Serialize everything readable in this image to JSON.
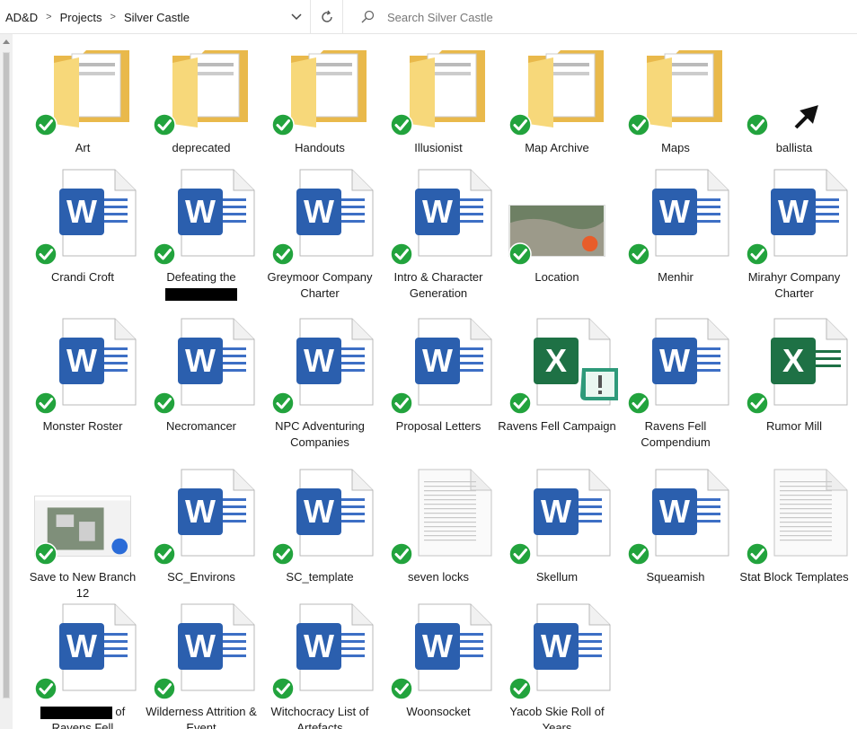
{
  "breadcrumb": [
    "AD&D",
    "Projects",
    "Silver Castle"
  ],
  "search": {
    "placeholder": "Search Silver Castle"
  },
  "icons": {
    "refresh": "refresh-icon",
    "search": "search-icon",
    "chevron": "chevron-down-icon",
    "sync": "synced-check-icon"
  },
  "colors": {
    "word": "#2b5fae",
    "excel": "#1e7145",
    "folder": "#f5d06b",
    "check": "#22a33d"
  },
  "items": [
    {
      "label": "Art",
      "type": "folder"
    },
    {
      "label": "deprecated",
      "type": "folder"
    },
    {
      "label": "Handouts",
      "type": "folder"
    },
    {
      "label": "Illusionist",
      "type": "folder"
    },
    {
      "label": "Map Archive",
      "type": "folder"
    },
    {
      "label": "Maps",
      "type": "folder"
    },
    {
      "label": "ballista",
      "type": "image"
    },
    {
      "label": "Crandi Croft",
      "type": "word"
    },
    {
      "label": "Defeating the",
      "type": "word",
      "redacted": true
    },
    {
      "label": "Greymoor Company Charter",
      "type": "word"
    },
    {
      "label": "Intro & Character Generation",
      "type": "word"
    },
    {
      "label": "Location",
      "type": "image"
    },
    {
      "label": "Menhir",
      "type": "word"
    },
    {
      "label": "Mirahyr Company Charter",
      "type": "word"
    },
    {
      "label": "Monster Roster",
      "type": "word"
    },
    {
      "label": "Necromancer",
      "type": "word"
    },
    {
      "label": "NPC Adventuring Companies",
      "type": "word"
    },
    {
      "label": "Proposal Letters",
      "type": "word"
    },
    {
      "label": "Ravens Fell Campaign",
      "type": "excel"
    },
    {
      "label": "Ravens Fell Compendium",
      "type": "word"
    },
    {
      "label": "Rumor Mill",
      "type": "excel"
    },
    {
      "label": "Save to New Branch 12",
      "type": "image"
    },
    {
      "label": "SC_Environs",
      "type": "word"
    },
    {
      "label": "SC_template",
      "type": "word"
    },
    {
      "label": "seven locks",
      "type": "text"
    },
    {
      "label": "Skellum",
      "type": "word"
    },
    {
      "label": "Squeamish",
      "type": "word"
    },
    {
      "label": "Stat Block Templates",
      "type": "text"
    },
    {
      "label": "of Ravens Fell",
      "type": "word",
      "redacted": true
    },
    {
      "label": "Wilderness Attrition & Event",
      "type": "word"
    },
    {
      "label": "Witchocracy List of Artefacts",
      "type": "word"
    },
    {
      "label": "Woonsocket",
      "type": "word"
    },
    {
      "label": "Yacob Skie Roll of Years",
      "type": "word"
    }
  ]
}
